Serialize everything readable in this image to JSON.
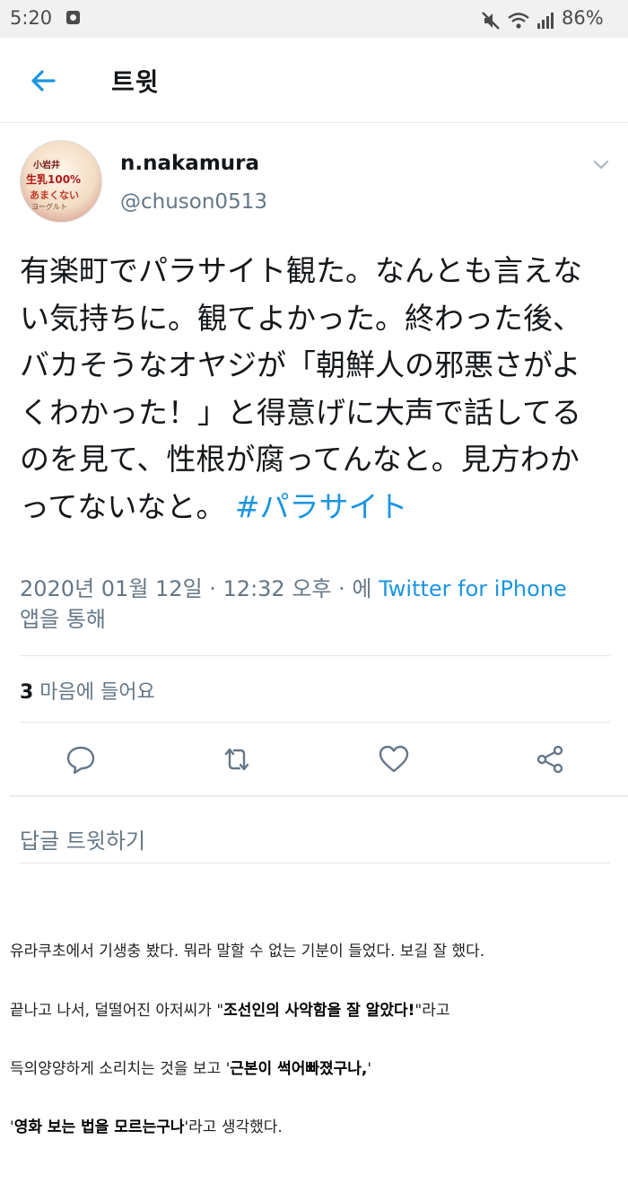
{
  "status_bar": {
    "time": "5:20",
    "battery": "86%",
    "icons": [
      "notification-icon",
      "mute-icon",
      "wifi-icon",
      "signal-icon"
    ]
  },
  "header": {
    "title": "트윗"
  },
  "tweet": {
    "display_name": "n.nakamura",
    "handle": "@chuson0513",
    "avatar_text": {
      "top": "小岩井",
      "line1": "生乳100%",
      "line2": "あまくない",
      "line3": "ヨーグルト"
    },
    "text": "有楽町でパラサイト観た。なんとも言えない気持ちに。観てよかった。終わった後、バカそうなオヤジが「朝鮮人の邪悪さがよくわかった！」と得意げに大声で話してるのを見て、性根が腐ってんなと。見方わかってないなと。",
    "hashtag": "#パラサイト",
    "timestamp": "2020년 01월 12일 · 12:32 오후 · 에 ",
    "source": "Twitter for iPhone",
    "source_suffix": "앱을 통해",
    "likes_count": "3",
    "likes_label": " 마음에 들어요",
    "colors": {
      "link": "#1b95e0",
      "secondary": "#657786",
      "divider": "#e1e8ed"
    }
  },
  "actions": [
    "reply-icon",
    "retweet-icon",
    "like-icon",
    "share-icon"
  ],
  "reply_box": {
    "placeholder": "답글 트윗하기"
  },
  "caption": {
    "line1": "유라쿠초에서 기생충 봤다. 뭐라 말할 수 없는 기분이 들었다. 보길 잘 했다.",
    "line2_pre": "끝나고 나서, 덜떨어진 아저씨가 \"",
    "line2_bold": "조선인의 사악함을 잘 알았다!",
    "line2_post": "\"라고",
    "line3_pre": "득의양양하게 소리치는 것을 보고 '",
    "line3_bold": "근본이 썩어빠졌구나,",
    "line3_post": "'",
    "line4_pre": "'",
    "line4_bold": "영화 보는 법을 모르는구나",
    "line4_post": "'라고 생각했다."
  }
}
